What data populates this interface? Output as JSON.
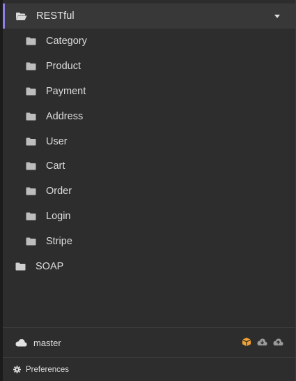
{
  "tree": {
    "root": {
      "label": "RESTful",
      "icon": "folder-open-icon",
      "expanded": true,
      "children": [
        {
          "label": "Category",
          "icon": "folder-icon"
        },
        {
          "label": "Product",
          "icon": "folder-icon"
        },
        {
          "label": "Payment",
          "icon": "folder-icon"
        },
        {
          "label": "Address",
          "icon": "folder-icon"
        },
        {
          "label": "User",
          "icon": "folder-icon"
        },
        {
          "label": "Cart",
          "icon": "folder-icon"
        },
        {
          "label": "Order",
          "icon": "folder-icon"
        },
        {
          "label": "Login",
          "icon": "folder-icon"
        },
        {
          "label": "Stripe",
          "icon": "folder-icon"
        }
      ]
    },
    "root2": {
      "label": "SOAP",
      "icon": "folder-icon",
      "expanded": false
    }
  },
  "git": {
    "branch_label": "master",
    "branch_icon": "cloud-icon",
    "actions": [
      "package-icon",
      "cloud-download-icon",
      "cloud-upload-icon"
    ]
  },
  "preferences": {
    "label": "Preferences",
    "icon": "gear-icon"
  },
  "colors": {
    "accent": "#8b7fe8",
    "package": "#f0a030",
    "background": "#2d2d2d",
    "selected_row": "#383838"
  }
}
